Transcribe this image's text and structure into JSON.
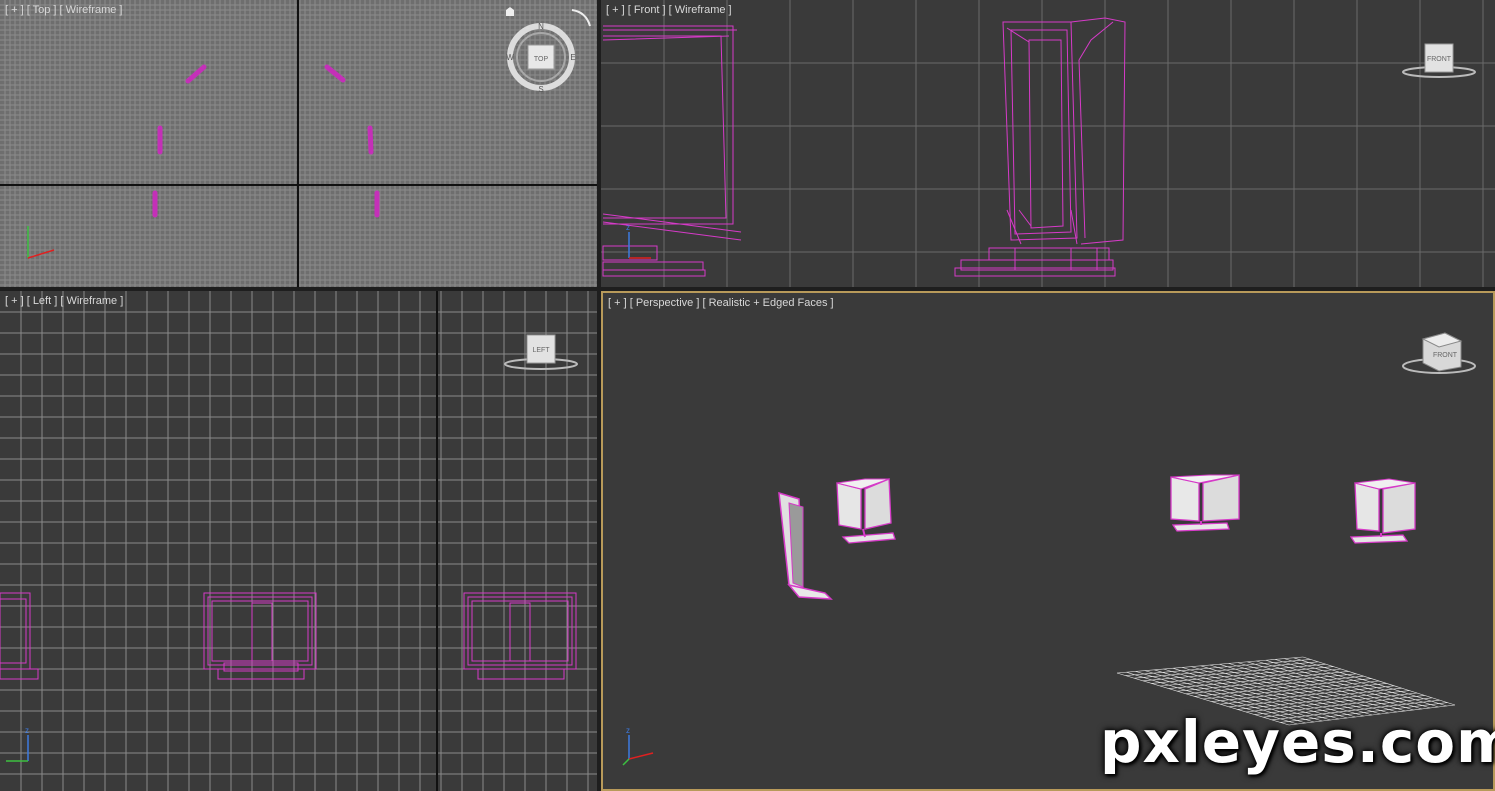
{
  "viewports": {
    "top": {
      "label": "[ + ] [ Top ] [ Wireframe ]",
      "cube_label": "TOP",
      "compass": [
        "N",
        "E",
        "S",
        "W"
      ]
    },
    "front": {
      "label": "[ + ] [ Front ] [ Wireframe ]",
      "cube_label": "FRONT"
    },
    "left": {
      "label": "[ + ] [ Left ] [ Wireframe ]",
      "cube_label": "LEFT"
    },
    "perspective": {
      "label": "[ + ] [ Perspective ] [ Realistic + Edged Faces ]",
      "cube_label": "FRONT",
      "active": true
    }
  },
  "axis": {
    "x": "x",
    "y": "y",
    "z": "z"
  },
  "watermark": "pxleyes.com",
  "colors": {
    "wire": "#d63ac8",
    "grid_light": "#8a8a8a",
    "grid_dark": "#5a5a5a",
    "active_border": "#b89a5a"
  }
}
